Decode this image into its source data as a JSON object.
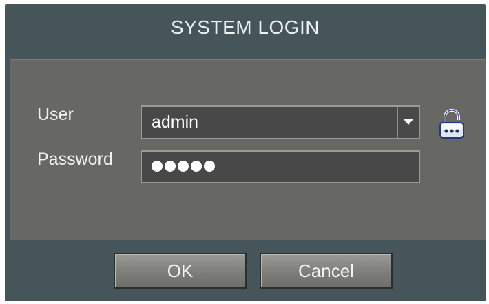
{
  "dialog": {
    "title": "SYSTEM LOGIN"
  },
  "form": {
    "user_label": "User",
    "user_value": "admin",
    "password_label": "Password",
    "password_masked_length": 5
  },
  "icons": {
    "dropdown": "chevron-down-icon",
    "lock": "lock-icon"
  },
  "buttons": {
    "ok_label": "OK",
    "cancel_label": "Cancel"
  },
  "colors": {
    "header": "#465559",
    "panel": "#676864",
    "field": "#494848"
  }
}
